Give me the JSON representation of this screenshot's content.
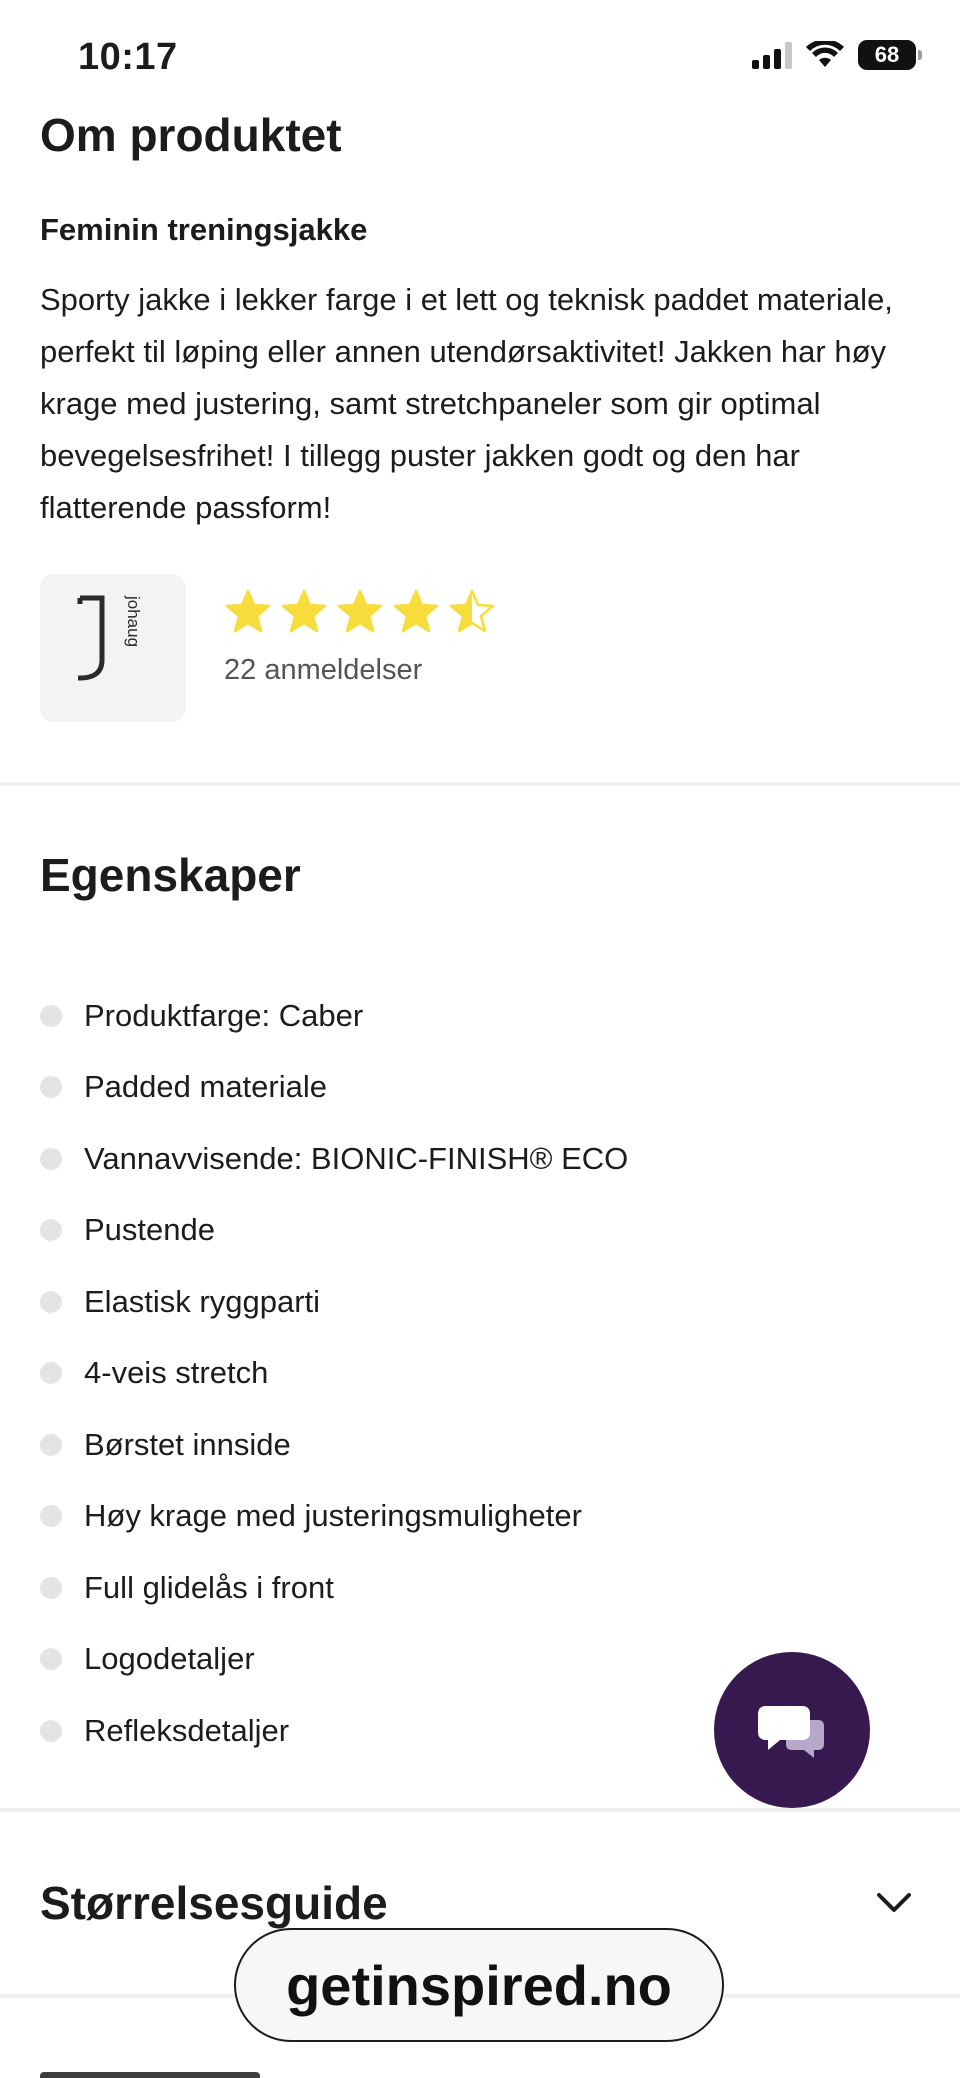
{
  "status_bar": {
    "time": "10:17",
    "battery": "68"
  },
  "about": {
    "title": "Om produktet",
    "product_name": "Feminin treningsjakke",
    "description": "Sporty jakke i lekker farge i et lett og teknisk paddet materiale, perfekt til løping eller annen utendørsaktivitet! Jakken har høy krage med justering, samt stretchpaneler som gir optimal bevegelsesfrihet! I tillegg puster jakken godt og den har flatterende passform!",
    "brand_logo_text": "johaug",
    "rating": 4.5,
    "rating_max": 5,
    "review_count": "22 anmeldelser"
  },
  "properties": {
    "title": "Egenskaper",
    "items": [
      "Produktfarge: Caber",
      "Padded materiale",
      "Vannavvisende: BIONIC-FINISH® ECO",
      "Pustende",
      "Elastisk ryggparti",
      "4-veis stretch",
      "Børstet innside",
      "Høy krage med justeringsmuligheter",
      "Full glidelås i front",
      "Logodetaljer",
      "Refleksdetaljer"
    ]
  },
  "size_guide": {
    "title": "Størrelsesguide"
  },
  "url_pill": {
    "text": "getinspired.no"
  },
  "colors": {
    "star": "#f7dd3c",
    "chat_fab": "#36194f",
    "divider": "#efefef"
  },
  "icons": {
    "chat": "chat-bubbles-icon",
    "chevron": "chevron-down-icon",
    "signal": "cellular-signal-icon",
    "wifi": "wifi-icon",
    "battery": "battery-icon"
  }
}
